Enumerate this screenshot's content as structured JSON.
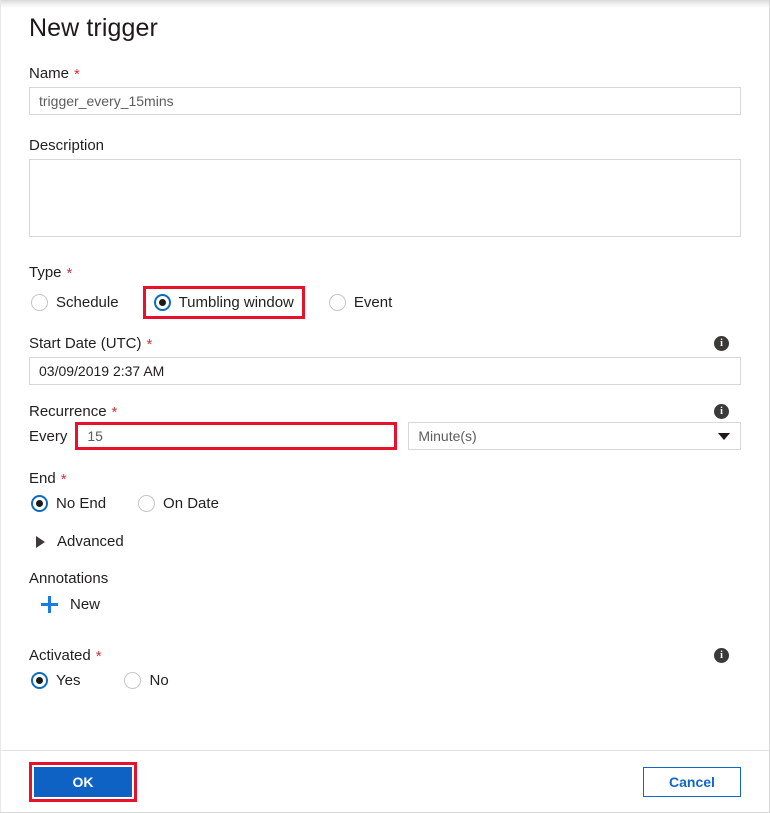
{
  "panel": {
    "title": "New trigger"
  },
  "name_field": {
    "label": "Name",
    "required_mark": "*",
    "value": "trigger_every_15mins"
  },
  "description_field": {
    "label": "Description",
    "value": ""
  },
  "type_field": {
    "label": "Type",
    "required_mark": "*",
    "options": [
      {
        "label": "Schedule",
        "selected": false
      },
      {
        "label": "Tumbling window",
        "selected": true,
        "highlighted": true
      },
      {
        "label": "Event",
        "selected": false
      }
    ]
  },
  "start_date_field": {
    "label": "Start Date (UTC)",
    "required_mark": "*",
    "value": "03/09/2019 2:37 AM",
    "info_icon": "info-icon"
  },
  "recurrence_field": {
    "label": "Recurrence",
    "required_mark": "*",
    "info_icon": "info-icon",
    "every_label": "Every",
    "interval_value": "15",
    "interval_highlighted": true,
    "unit_value": "Minute(s)",
    "unit_caret_icon": "chevron-down-icon"
  },
  "end_field": {
    "label": "End",
    "required_mark": "*",
    "options": [
      {
        "label": "No End",
        "selected": true
      },
      {
        "label": "On Date",
        "selected": false
      }
    ]
  },
  "advanced_section": {
    "label": "Advanced",
    "expand_icon": "triangle-right-icon",
    "expanded": false
  },
  "annotations_section": {
    "label": "Annotations",
    "new_label": "New",
    "new_icon": "plus-icon"
  },
  "activated_field": {
    "label": "Activated",
    "required_mark": "*",
    "info_icon": "info-icon",
    "options": [
      {
        "label": "Yes",
        "selected": true
      },
      {
        "label": "No",
        "selected": false
      }
    ]
  },
  "footer": {
    "ok_label": "OK",
    "ok_highlighted": true,
    "cancel_label": "Cancel"
  },
  "colors": {
    "accent_blue": "#0d62c4",
    "link_blue": "#1266c4",
    "highlight_red": "#e8112d",
    "required_red": "#d13438",
    "plus_blue": "#1a7ae8"
  }
}
